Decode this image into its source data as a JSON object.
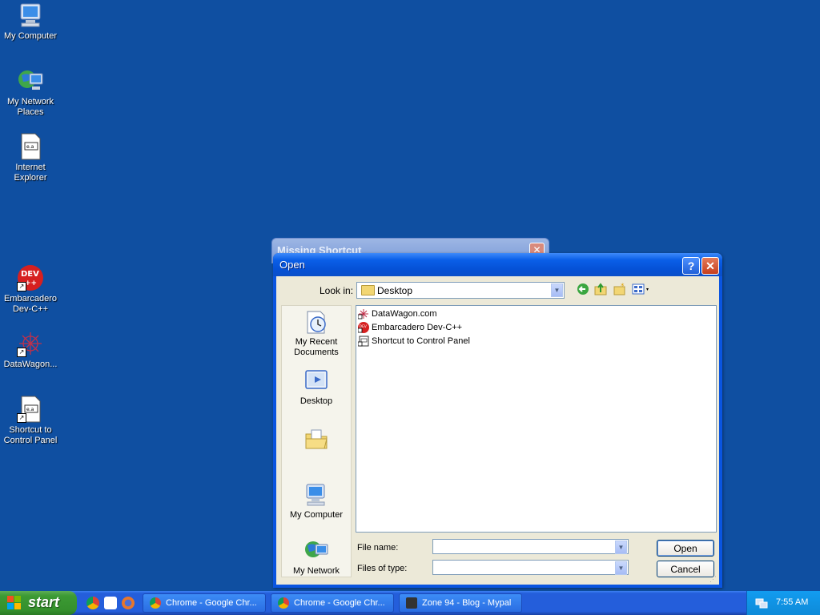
{
  "desktop": {
    "icons": [
      {
        "label": "My Computer"
      },
      {
        "label": "My Network Places"
      },
      {
        "label": "Internet Explorer"
      },
      {
        "label": "Embarcadero Dev-C++"
      },
      {
        "label": "DataWagon..."
      },
      {
        "label": "Shortcut to Control Panel"
      }
    ]
  },
  "background_dialog": {
    "title": "Missing Shortcut"
  },
  "open_dialog": {
    "title": "Open",
    "help_glyph": "?",
    "close_glyph": "✕",
    "look_in_label": "Look in:",
    "look_in_value": "Desktop",
    "places": [
      {
        "label": "My Recent Documents"
      },
      {
        "label": "Desktop"
      },
      {
        "label": ""
      },
      {
        "label": "My Computer"
      },
      {
        "label": "My Network"
      }
    ],
    "files": [
      {
        "name": "DataWagon.com"
      },
      {
        "name": "Embarcadero Dev-C++"
      },
      {
        "name": "Shortcut to Control Panel"
      }
    ],
    "file_name_label": "File name:",
    "file_name_value": "",
    "file_type_label": "Files of type:",
    "file_type_value": "",
    "open_button": "Open",
    "cancel_button": "Cancel"
  },
  "taskbar": {
    "start_label": "start",
    "tasks": [
      {
        "label": "Chrome - Google Chr..."
      },
      {
        "label": "Chrome - Google Chr..."
      },
      {
        "label": "Zone 94 - Blog - Mypal"
      }
    ],
    "clock": "7:55 AM"
  },
  "colors": {
    "desktop_bg": "#0f4fa1",
    "title_blue": "#0a55e0",
    "start_green": "#3c9a34",
    "close_red": "#c7401d"
  }
}
